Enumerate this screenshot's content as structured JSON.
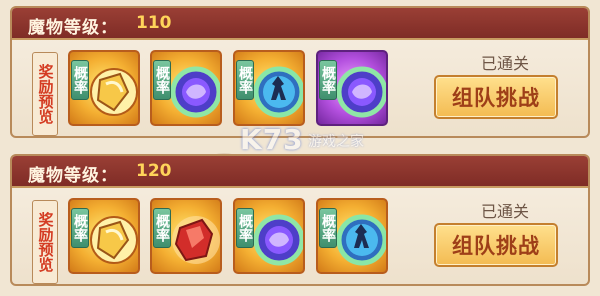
{
  "panels": [
    {
      "level_label": "魔物等级：",
      "level_value": "110",
      "reward_tag": "奖励预览",
      "status": "已通关",
      "button_label": "组队挑战",
      "rewards": [
        {
          "probability_label": "概率",
          "icon": "gold-relic-icon"
        },
        {
          "probability_label": "概率",
          "icon": "purple-orb-icon"
        },
        {
          "probability_label": "概率",
          "icon": "cyan-warrior-icon"
        },
        {
          "probability_label": "概率",
          "icon": "purple-orb-icon"
        }
      ]
    },
    {
      "level_label": "魔物等级：",
      "level_value": "120",
      "reward_tag": "奖励预览",
      "status": "已通关",
      "button_label": "组队挑战",
      "rewards": [
        {
          "probability_label": "概率",
          "icon": "gold-relic-icon"
        },
        {
          "probability_label": "概率",
          "icon": "red-crystal-icon"
        },
        {
          "probability_label": "概率",
          "icon": "purple-orb-icon"
        },
        {
          "probability_label": "概率",
          "icon": "cyan-warrior-icon"
        }
      ]
    }
  ],
  "watermark": {
    "logo": "K73",
    "text": "游戏之家"
  },
  "colors": {
    "header_bg": "#8f362f",
    "level_value": "#ffd45a",
    "reward_tag_text": "#d43b22",
    "button_bg": "#f3bb52",
    "button_text": "#9e3f18"
  }
}
